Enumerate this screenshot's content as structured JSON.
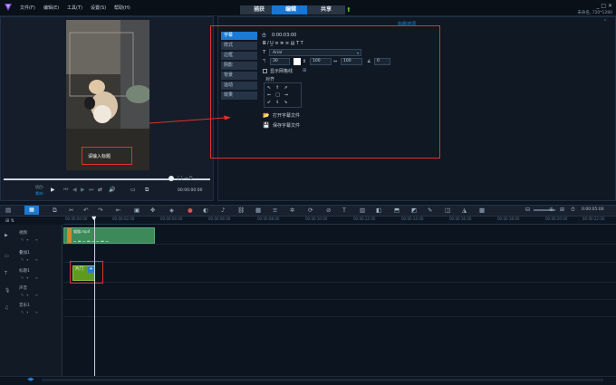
{
  "app": {
    "menu": [
      "文件(F)",
      "编辑(E)",
      "工具(T)",
      "设置(S)",
      "帮助(H)"
    ],
    "tabs": [
      {
        "label": "捕获",
        "active": false
      },
      {
        "label": "编辑",
        "active": true
      },
      {
        "label": "共享",
        "active": false
      }
    ],
    "window_controls": "_ □ ✕",
    "project_info": "未命名, 720*1280"
  },
  "preview": {
    "title_overlay": "请输入标题",
    "project_label": "项目-",
    "clip_label": "素材-",
    "timecode": "00:00:00:00"
  },
  "options": {
    "header_link": "标题选项",
    "sidebar": [
      "字幕",
      "样式",
      "边框",
      "阴影",
      "背景",
      "运动",
      "效果"
    ],
    "active_sidebar": 0,
    "duration": "0:00:03:00",
    "font": "Arial",
    "font_size": "30",
    "line_spacing": "100",
    "char_spacing": "100",
    "angle": "0",
    "show_grid": "显示网格线",
    "align_label": "对齐",
    "open_subtitle": "打开字幕文件",
    "save_subtitle": "保存字幕文件"
  },
  "timeline": {
    "end_timecode": "0:00:05:00",
    "ruler": [
      "00:00:00:00",
      "00:00:02:00",
      "00:00:04:00",
      "00:00:06:00",
      "00:00:08:00",
      "00:00:10:00",
      "00:00:12:00",
      "00:00:14:00",
      "00:00:16:00",
      "00:00:18:00",
      "00:00:20:00",
      "00:00:22:00"
    ],
    "tracks": [
      {
        "name": "视频"
      },
      {
        "name": "叠加1"
      },
      {
        "name": "标题1"
      },
      {
        "name": "声音"
      },
      {
        "name": "音乐1"
      }
    ],
    "video_clip": "猫猫.mp4",
    "title_clip": "片门"
  },
  "colors": {
    "accent": "#1976d2",
    "annotation": "#e03030",
    "clip_video": "#3c8a5a",
    "clip_title": "#5e9a1e"
  }
}
